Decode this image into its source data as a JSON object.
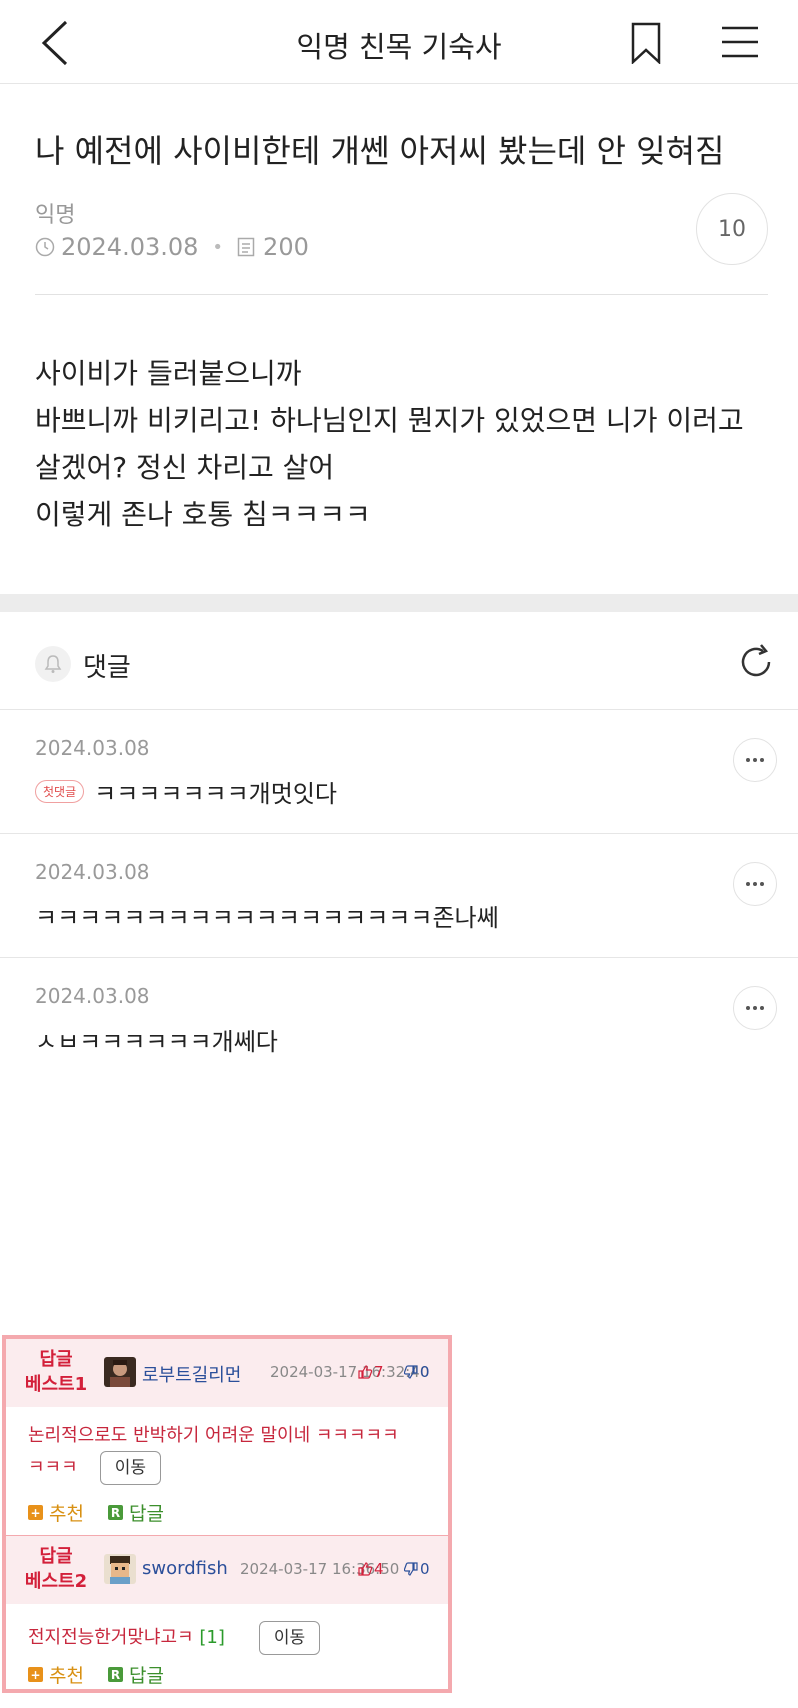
{
  "header": {
    "title": "익명 친목 기숙사"
  },
  "post": {
    "title": "나 예전에 사이비한테 개쎈 아저씨 봤는데 안 잊혀짐",
    "author": "익명",
    "date": "2024.03.08",
    "views": "200",
    "comment_count": "10",
    "body": [
      "사이비가 들러붙으니까",
      "바쁘니까 비키리고! 하나님인지 뭔지가 있었으면 니가 이러고",
      "살겠어? 정신 차리고 살어",
      "이렇게 존나 호통 침ㅋㅋㅋㅋ"
    ]
  },
  "comments_section": {
    "label": "댓글"
  },
  "comments": [
    {
      "date": "2024.03.08",
      "badge": "첫댓글",
      "text": "ㅋㅋㅋㅋㅋㅋㅋ개멋잇다"
    },
    {
      "date": "2024.03.08",
      "text": "ㅋㅋㅋㅋㅋㅋㅋㅋㅋㅋㅋㅋㅋㅋㅋㅋㅋㅋ존나쎄"
    },
    {
      "date": "2024.03.08",
      "text": "ㅅㅂㅋㅋㅋㅋㅋㅋ개쎄다"
    }
  ],
  "best_replies": [
    {
      "label_line1": "답글",
      "label_line2": "베스트1",
      "user": "로부트길리먼",
      "timestamp": "2024-03-17 16:32:40",
      "up": "7",
      "down": "0",
      "text_line1": "논리적으로도 반박하기 어려운 말이네 ㅋㅋㅋㅋㅋ",
      "text_line2": "ㅋㅋㅋ",
      "reply_count": "",
      "move_label": "이동",
      "recommend_label": "추천",
      "reply_label": "답글"
    },
    {
      "label_line1": "답글",
      "label_line2": "베스트2",
      "user": "swordfish",
      "timestamp": "2024-03-17 16:36:50",
      "up": "4",
      "down": "0",
      "text_line1": "전지전능한거맞냐고ㅋ",
      "text_line2": "",
      "reply_count": "[1]",
      "move_label": "이동",
      "recommend_label": "추천",
      "reply_label": "답글"
    }
  ],
  "colors": {
    "best_accent": "#d3203a",
    "best_border": "#f4a9ae",
    "best_row_bg": "#fbecee"
  }
}
